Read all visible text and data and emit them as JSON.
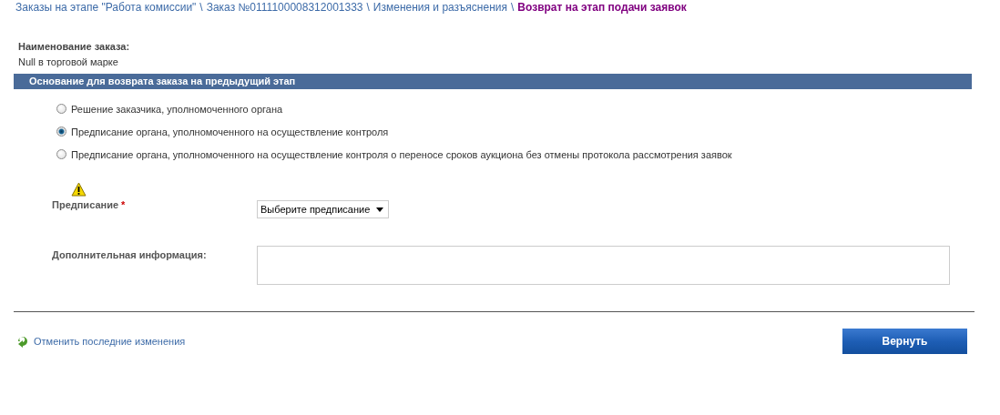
{
  "breadcrumb": [
    {
      "text": "Заказы на этапе \"Работа комиссии\"",
      "separator": "\\",
      "current": false
    },
    {
      "text": "Заказ №0111100008312001333",
      "separator": "\\",
      "current": false
    },
    {
      "text": "Изменения и разъяснения",
      "separator": "\\",
      "current": false
    },
    {
      "text": "Возврат на этап подачи заявок",
      "current": true
    }
  ],
  "order": {
    "label": "Наименование заказа:",
    "value": "Null в торговой марке"
  },
  "section": {
    "title": "Основание для возврата заказа на предыдущий этап"
  },
  "reasons": [
    {
      "label": "Решение заказчика, уполномоченного органа",
      "selected": false
    },
    {
      "label": "Предписание органа, уполномоченного на осуществление контроля",
      "selected": true
    },
    {
      "label": "Предписание органа, уполномоченного на осуществление контроля о переносе сроков аукциона без отмены протокола рассмотрения заявок",
      "selected": false
    }
  ],
  "prescription": {
    "label": "Предписание",
    "required_mark": "*",
    "warning": true,
    "value": "Выберите предписание"
  },
  "additional_info": {
    "label": "Дополнительная информация:"
  },
  "undo_link": "Отменить последние изменения",
  "submit_button": "Вернуть"
}
